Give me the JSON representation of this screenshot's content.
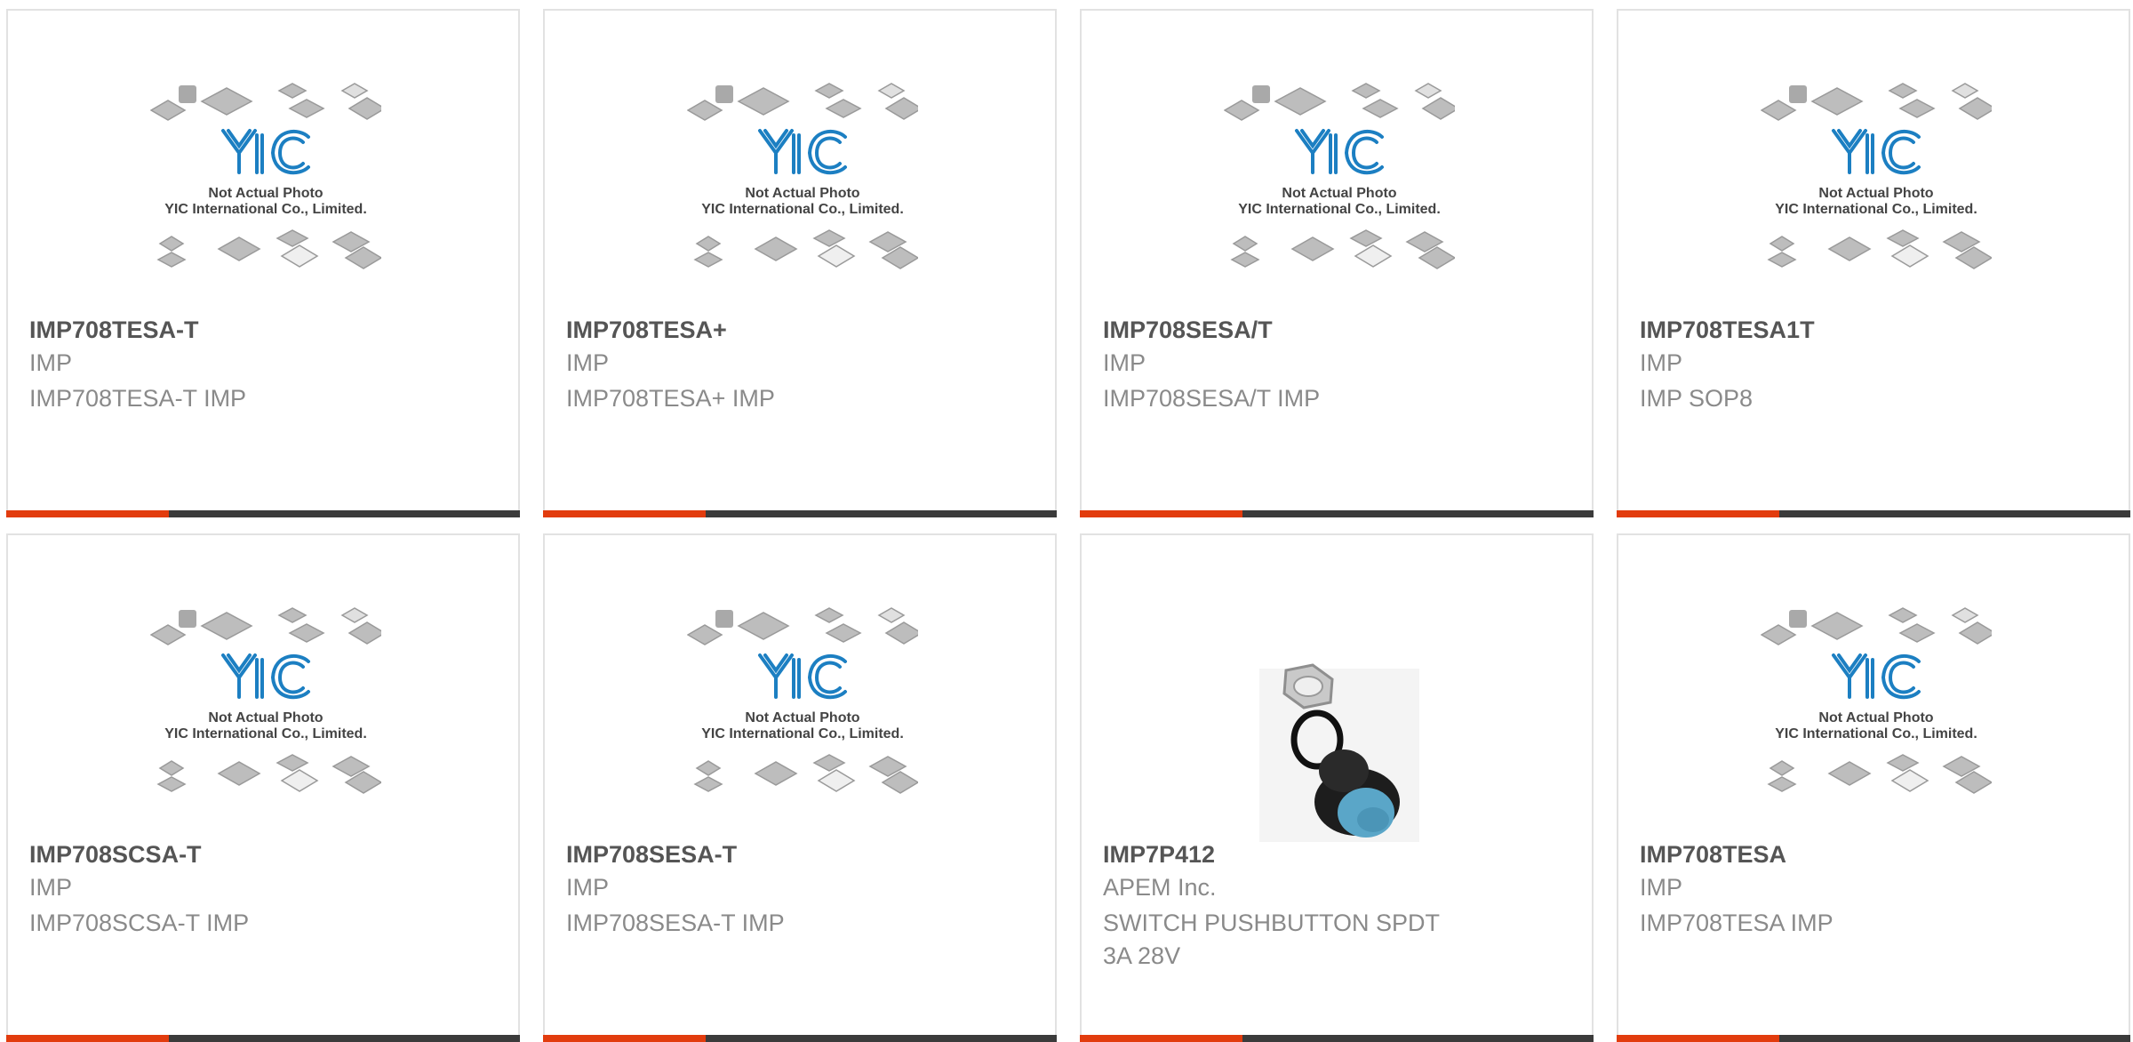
{
  "placeholder": {
    "line1": "Not Actual Photo",
    "line2": "YIC International Co., Limited.",
    "logo_text": "YIC"
  },
  "colors": {
    "accent": "#e23c0e",
    "bar": "#3b3b3b",
    "logo_blue": "#1c7fc2",
    "switch_cap": "#5aa6c8"
  },
  "products": [
    {
      "part": "IMP708TESA-T",
      "manufacturer": "IMP",
      "description": "IMP708TESA-T IMP",
      "image": "placeholder-image"
    },
    {
      "part": "IMP708TESA+",
      "manufacturer": "IMP",
      "description": "IMP708TESA+ IMP",
      "image": "placeholder-image"
    },
    {
      "part": "IMP708SESA/T",
      "manufacturer": "IMP",
      "description": "IMP708SESA/T IMP",
      "image": "placeholder-image"
    },
    {
      "part": "IMP708TESA1T",
      "manufacturer": "IMP",
      "description": "IMP SOP8",
      "image": "placeholder-image"
    },
    {
      "part": "IMP708SCSA-T",
      "manufacturer": "IMP",
      "description": "IMP708SCSA-T IMP",
      "image": "placeholder-image"
    },
    {
      "part": "IMP708SESA-T",
      "manufacturer": "IMP",
      "description": "IMP708SESA-T IMP",
      "image": "placeholder-image"
    },
    {
      "part": "IMP7P412",
      "manufacturer": "APEM Inc.",
      "description": "SWITCH PUSHBUTTON SPDT 3A 28V",
      "image": "pushbutton-switch-photo"
    },
    {
      "part": "IMP708TESA",
      "manufacturer": "IMP",
      "description": "IMP708TESA IMP",
      "image": "placeholder-image"
    }
  ]
}
